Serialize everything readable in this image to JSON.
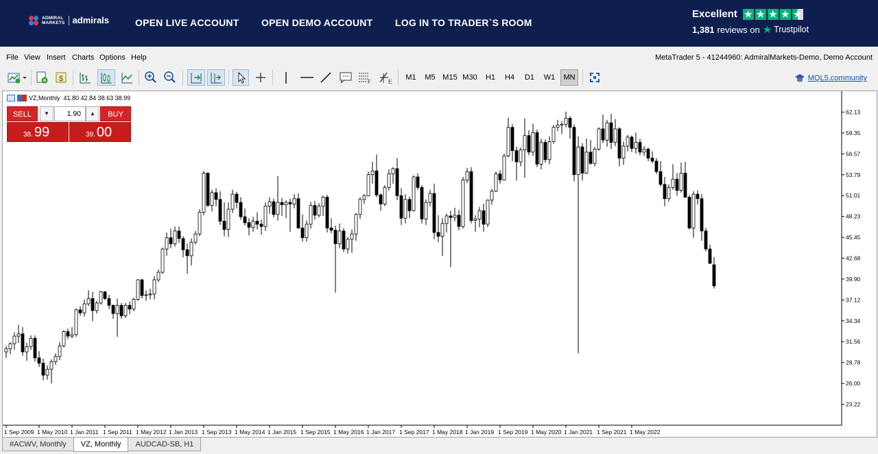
{
  "banner": {
    "logo_small": "ADMIRAL\nMARKETS",
    "logo_main": "admirals",
    "nav": [
      "OPEN LIVE ACCOUNT",
      "OPEN DEMO ACCOUNT",
      "LOG IN TO TRADER`S ROOM"
    ],
    "trustpilot_rating": "Excellent",
    "trustpilot_reviews": "1,381",
    "trustpilot_reviews_suffix": "reviews on",
    "trustpilot_brand": "Trustpilot",
    "stars": 4.5,
    "colors": {
      "banner_bg": "#0e1f4f",
      "trustpilot_green": "#00b67a"
    }
  },
  "menu": {
    "items": [
      "File",
      "View",
      "Insert",
      "Charts",
      "Options",
      "Help"
    ],
    "account": "MetaTrader 5 - 41244960: AdmiralMarkets-Demo, Demo Account"
  },
  "toolbar": {
    "timeframes": [
      "M1",
      "M5",
      "M15",
      "M30",
      "H1",
      "H4",
      "D1",
      "W1",
      "MN"
    ],
    "active_timeframe": "MN",
    "mql_link": "MQL5.community",
    "icons": [
      "new-chart-icon",
      "new-order-icon",
      "market-watch-icon",
      "bar-chart-icon",
      "candlestick-icon",
      "line-chart-icon",
      "zoom-in-icon",
      "zoom-out-icon",
      "autoscroll-icon",
      "chart-shift-icon",
      "cursor-icon",
      "crosshair-icon",
      "vertical-line-icon",
      "horizontal-line-icon",
      "trendline-icon",
      "text-icon",
      "fibonacci-icon",
      "objects-icon",
      "fullscreen-icon"
    ]
  },
  "chart_window": {
    "symbol_info": "VZ,Monthly",
    "ohlc": "41.80 42.84 38.63 38.99"
  },
  "trade_panel": {
    "sell_label": "SELL",
    "buy_label": "BUY",
    "lot": "1.90",
    "sell_small": "38.",
    "sell_big": "99",
    "buy_small": "39.",
    "buy_big": "00"
  },
  "tabs": [
    "#ACWV, Monthly",
    "VZ, Monthly",
    "AUDCAD-SB, H1"
  ],
  "active_tab": "VZ, Monthly",
  "chart_data": {
    "type": "candlestick",
    "symbol": "VZ",
    "timeframe": "Monthly",
    "ylim": [
      20.44,
      64.91
    ],
    "y_ticks": [
      "62.13",
      "59.35",
      "56.57",
      "53.79",
      "51.01",
      "48.23",
      "45.45",
      "42.68",
      "39.90",
      "37.12",
      "34.34",
      "31.56",
      "28.78",
      "26.00",
      "23.22"
    ],
    "x_ticks": [
      "1 Sep 2009",
      "1 May 2010",
      "1 Jan 2011",
      "1 Sep 2011",
      "1 May 2012",
      "1 Jan 2013",
      "1 Sep 2013",
      "1 May 2014",
      "1 Jan 2015",
      "1 Sep 2015",
      "1 May 2016",
      "1 Jan 2017",
      "1 Sep 2017",
      "1 May 2018",
      "1 Jan 2019",
      "1 Sep 2019",
      "1 May 2020",
      "1 Jan 2021",
      "1 Sep 2021",
      "1 May 2022"
    ],
    "bull_color": "#ffffff",
    "bear_color": "#000000",
    "grid": false,
    "candles": [
      [
        30.2,
        31.0,
        29.4,
        30.6
      ],
      [
        30.6,
        31.5,
        29.9,
        31.3
      ],
      [
        31.3,
        32.8,
        30.5,
        32.3
      ],
      [
        32.3,
        33.8,
        31.4,
        32.6
      ],
      [
        32.6,
        33.5,
        29.7,
        30.2
      ],
      [
        30.2,
        31.4,
        29.0,
        30.9
      ],
      [
        30.9,
        32.4,
        30.5,
        32.0
      ],
      [
        32.0,
        32.4,
        28.9,
        29.4
      ],
      [
        29.4,
        30.3,
        28.2,
        28.7
      ],
      [
        28.7,
        29.3,
        26.4,
        27.1
      ],
      [
        27.1,
        28.4,
        26.5,
        27.9
      ],
      [
        27.9,
        29.2,
        26.0,
        28.9
      ],
      [
        28.9,
        30.0,
        28.5,
        29.6
      ],
      [
        29.6,
        31.5,
        29.1,
        31.0
      ],
      [
        31.0,
        33.1,
        30.8,
        32.9
      ],
      [
        32.9,
        33.3,
        31.9,
        32.3
      ],
      [
        32.3,
        33.5,
        32.0,
        32.5
      ],
      [
        32.5,
        36.0,
        32.2,
        35.8
      ],
      [
        35.8,
        36.3,
        35.0,
        35.4
      ],
      [
        35.4,
        37.2,
        34.9,
        36.6
      ],
      [
        36.6,
        38.4,
        36.3,
        37.3
      ],
      [
        37.3,
        38.2,
        34.3,
        35.7
      ],
      [
        35.7,
        37.0,
        35.3,
        36.7
      ],
      [
        36.7,
        38.3,
        36.5,
        38.2
      ],
      [
        38.2,
        38.3,
        37.1,
        37.3
      ],
      [
        37.3,
        37.8,
        35.9,
        36.4
      ],
      [
        36.4,
        36.5,
        34.6,
        35.3
      ],
      [
        35.3,
        37.3,
        32.2,
        36.4
      ],
      [
        36.4,
        36.7,
        34.6,
        35.0
      ],
      [
        35.0,
        36.7,
        34.7,
        36.4
      ],
      [
        36.4,
        36.9,
        35.2,
        35.9
      ],
      [
        35.9,
        37.4,
        35.6,
        37.2
      ],
      [
        37.2,
        39.9,
        37.0,
        39.8
      ],
      [
        39.8,
        39.9,
        37.3,
        37.7
      ],
      [
        37.7,
        38.4,
        37.0,
        37.8
      ],
      [
        37.8,
        38.6,
        37.2,
        37.9
      ],
      [
        37.9,
        40.3,
        37.2,
        39.8
      ],
      [
        39.8,
        41.2,
        39.5,
        40.8
      ],
      [
        40.8,
        44.1,
        40.6,
        43.9
      ],
      [
        43.9,
        46.1,
        43.0,
        45.4
      ],
      [
        45.4,
        46.6,
        44.0,
        44.6
      ],
      [
        44.6,
        46.9,
        44.2,
        46.3
      ],
      [
        46.3,
        46.9,
        44.7,
        45.3
      ],
      [
        45.3,
        45.6,
        42.8,
        43.8
      ],
      [
        43.8,
        44.6,
        40.6,
        43.0
      ],
      [
        43.0,
        45.3,
        41.7,
        44.8
      ],
      [
        44.8,
        46.3,
        44.5,
        45.9
      ],
      [
        45.9,
        49.2,
        45.6,
        48.8
      ],
      [
        48.8,
        54.3,
        48.4,
        54.0
      ],
      [
        54.0,
        54.1,
        49.5,
        49.7
      ],
      [
        49.7,
        51.8,
        48.9,
        51.4
      ],
      [
        51.4,
        52.0,
        49.6,
        50.5
      ],
      [
        50.5,
        51.6,
        47.1,
        47.6
      ],
      [
        47.6,
        50.1,
        45.6,
        46.5
      ],
      [
        46.5,
        50.1,
        45.5,
        49.2
      ],
      [
        49.2,
        51.8,
        48.7,
        51.2
      ],
      [
        51.2,
        51.5,
        49.3,
        50.1
      ],
      [
        50.1,
        50.8,
        47.8,
        48.2
      ],
      [
        48.2,
        49.3,
        47.0,
        47.4
      ],
      [
        47.4,
        48.0,
        45.7,
        46.8
      ],
      [
        46.8,
        48.2,
        46.2,
        47.6
      ],
      [
        47.6,
        48.8,
        46.5,
        47.2
      ],
      [
        47.2,
        47.8,
        45.8,
        46.9
      ],
      [
        46.9,
        50.1,
        46.3,
        49.6
      ],
      [
        49.6,
        50.8,
        48.6,
        50.2
      ],
      [
        50.2,
        50.6,
        48.1,
        48.5
      ],
      [
        48.5,
        53.6,
        47.7,
        50.1
      ],
      [
        50.1,
        50.7,
        48.3,
        49.8
      ],
      [
        49.8,
        50.4,
        48.0,
        50.1
      ],
      [
        50.1,
        50.6,
        46.2,
        49.9
      ],
      [
        49.9,
        51.2,
        49.3,
        50.6
      ],
      [
        50.6,
        51.3,
        46.6,
        46.7
      ],
      [
        46.7,
        48.5,
        44.9,
        45.4
      ],
      [
        45.4,
        47.7,
        44.9,
        47.2
      ],
      [
        47.2,
        50.2,
        46.6,
        49.7
      ],
      [
        49.7,
        50.3,
        47.8,
        48.4
      ],
      [
        48.4,
        50.0,
        48.1,
        49.6
      ],
      [
        49.6,
        51.0,
        48.3,
        50.8
      ],
      [
        50.8,
        51.1,
        46.1,
        46.7
      ],
      [
        46.7,
        48.0,
        46.0,
        46.4
      ],
      [
        46.4,
        47.0,
        38.1,
        44.6
      ],
      [
        44.6,
        47.3,
        44.0,
        46.3
      ],
      [
        46.3,
        46.7,
        43.5,
        43.9
      ],
      [
        43.9,
        45.5,
        43.3,
        45.2
      ],
      [
        45.2,
        46.5,
        43.4,
        45.9
      ],
      [
        45.9,
        48.7,
        45.0,
        48.5
      ],
      [
        48.5,
        50.8,
        47.9,
        50.5
      ],
      [
        50.5,
        51.2,
        49.9,
        51.0
      ],
      [
        51.0,
        54.2,
        50.9,
        53.8
      ],
      [
        53.8,
        55.5,
        52.6,
        54.3
      ],
      [
        54.3,
        56.5,
        50.8,
        51.1
      ],
      [
        51.1,
        51.3,
        49.0,
        49.9
      ],
      [
        49.9,
        52.4,
        49.6,
        52.1
      ],
      [
        52.1,
        54.5,
        51.7,
        53.9
      ],
      [
        53.9,
        54.8,
        52.6,
        54.6
      ],
      [
        54.6,
        56.0,
        50.4,
        51.0
      ],
      [
        51.0,
        52.0,
        47.1,
        48.0
      ],
      [
        48.0,
        51.2,
        47.3,
        50.5
      ],
      [
        50.5,
        50.9,
        48.0,
        49.0
      ],
      [
        49.0,
        53.7,
        48.9,
        53.5
      ],
      [
        53.5,
        54.0,
        51.8,
        52.1
      ],
      [
        52.1,
        52.4,
        47.3,
        47.9
      ],
      [
        47.9,
        50.5,
        47.1,
        50.1
      ],
      [
        50.1,
        51.8,
        49.6,
        51.3
      ],
      [
        51.3,
        52.6,
        45.2,
        46.1
      ],
      [
        46.1,
        48.4,
        44.8,
        45.6
      ],
      [
        45.6,
        48.0,
        43.0,
        47.3
      ],
      [
        47.3,
        48.6,
        46.1,
        48.3
      ],
      [
        48.3,
        49.0,
        41.5,
        48.1
      ],
      [
        48.1,
        49.4,
        47.6,
        48.4
      ],
      [
        48.4,
        49.1,
        46.4,
        46.9
      ],
      [
        46.9,
        53.5,
        46.6,
        53.1
      ],
      [
        53.1,
        54.7,
        52.7,
        54.2
      ],
      [
        54.2,
        54.8,
        47.3,
        47.7
      ],
      [
        47.7,
        48.4,
        46.2,
        47.9
      ],
      [
        47.9,
        49.5,
        46.8,
        49.0
      ],
      [
        49.0,
        49.9,
        46.2,
        47.2
      ],
      [
        47.2,
        50.5,
        46.8,
        50.4
      ],
      [
        50.4,
        51.9,
        49.8,
        51.6
      ],
      [
        51.6,
        54.2,
        51.5,
        53.9
      ],
      [
        53.9,
        54.4,
        52.6,
        53.1
      ],
      [
        53.1,
        56.6,
        53.0,
        56.3
      ],
      [
        56.3,
        61.4,
        56.1,
        60.1
      ],
      [
        60.1,
        60.5,
        55.6,
        57.0
      ],
      [
        57.0,
        57.5,
        53.0,
        55.5
      ],
      [
        55.5,
        57.4,
        54.9,
        57.1
      ],
      [
        57.1,
        61.3,
        53.4,
        59.0
      ],
      [
        59.0,
        59.7,
        56.4,
        56.8
      ],
      [
        56.8,
        60.6,
        56.3,
        59.4
      ],
      [
        59.4,
        59.8,
        54.8,
        55.2
      ],
      [
        55.2,
        58.6,
        54.5,
        58.1
      ],
      [
        58.1,
        58.5,
        55.4,
        55.8
      ],
      [
        55.8,
        58.9,
        55.2,
        58.2
      ],
      [
        58.2,
        60.4,
        57.9,
        60.1
      ],
      [
        60.1,
        61.1,
        59.6,
        60.4
      ],
      [
        60.4,
        60.9,
        59.2,
        60.5
      ],
      [
        60.5,
        62.2,
        60.1,
        61.3
      ],
      [
        61.3,
        61.6,
        58.6,
        60.1
      ],
      [
        60.1,
        60.5,
        52.9,
        53.8
      ],
      [
        53.8,
        58.9,
        30.0,
        57.5
      ],
      [
        57.5,
        58.0,
        53.0,
        54.0
      ],
      [
        54.0,
        58.6,
        53.9,
        56.8
      ],
      [
        56.8,
        58.4,
        55.1,
        55.3
      ],
      [
        55.3,
        57.5,
        54.9,
        57.2
      ],
      [
        57.2,
        60.1,
        57.0,
        59.9
      ],
      [
        59.9,
        61.8,
        58.0,
        58.4
      ],
      [
        58.4,
        61.1,
        57.5,
        60.7
      ],
      [
        60.7,
        61.9,
        57.2,
        58.1
      ],
      [
        58.1,
        61.2,
        57.6,
        59.9
      ],
      [
        59.9,
        60.1,
        54.9,
        56.0
      ],
      [
        56.0,
        58.2,
        55.1,
        57.6
      ],
      [
        57.6,
        59.1,
        56.9,
        58.8
      ],
      [
        58.8,
        59.0,
        56.8,
        57.3
      ],
      [
        57.3,
        59.4,
        56.6,
        58.1
      ],
      [
        58.1,
        58.6,
        56.4,
        56.8
      ],
      [
        56.8,
        57.6,
        56.3,
        57.2
      ],
      [
        57.2,
        57.4,
        55.6,
        56.0
      ],
      [
        56.0,
        56.9,
        55.3,
        55.6
      ],
      [
        55.6,
        56.0,
        53.9,
        54.2
      ],
      [
        54.2,
        55.6,
        52.2,
        52.5
      ],
      [
        52.5,
        53.5,
        49.6,
        50.6
      ],
      [
        50.6,
        52.5,
        50.2,
        52.1
      ],
      [
        52.1,
        55.2,
        51.8,
        53.2
      ],
      [
        53.2,
        54.0,
        51.0,
        51.7
      ],
      [
        51.7,
        55.4,
        51.4,
        54.0
      ],
      [
        54.0,
        55.5,
        50.7,
        50.8
      ],
      [
        50.8,
        51.1,
        46.5,
        46.7
      ],
      [
        46.7,
        51.6,
        45.4,
        51.2
      ],
      [
        51.2,
        51.7,
        49.8,
        50.6
      ],
      [
        50.6,
        51.2,
        45.0,
        46.3
      ],
      [
        46.3,
        46.7,
        43.6,
        43.9
      ],
      [
        43.9,
        44.5,
        41.9,
        42.0
      ],
      [
        41.8,
        42.84,
        38.63,
        38.99
      ]
    ]
  }
}
